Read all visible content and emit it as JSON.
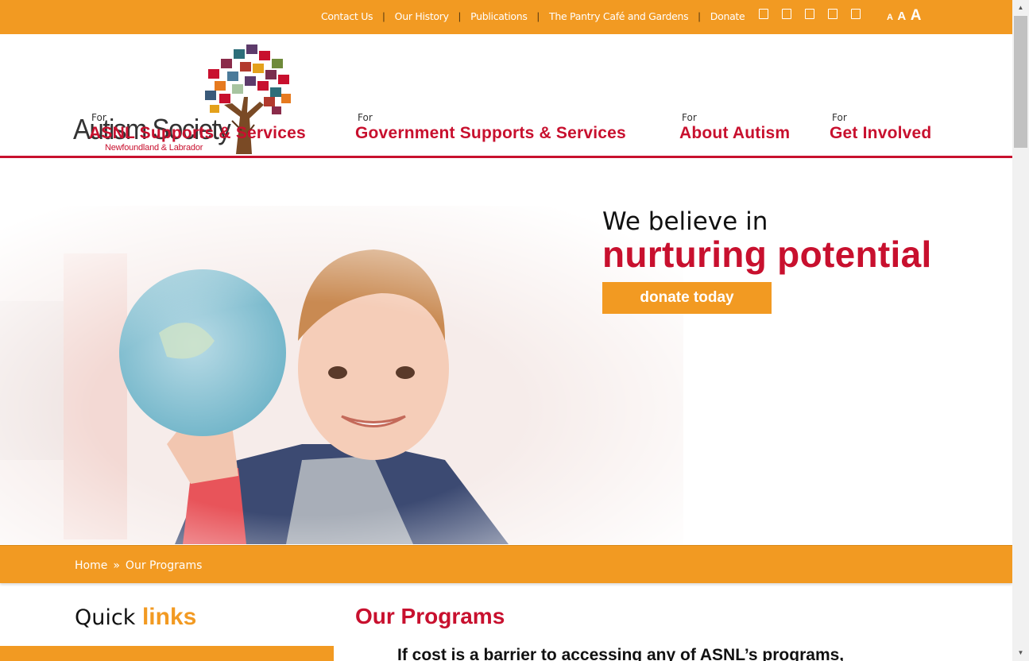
{
  "topbar": {
    "links": [
      "Contact Us",
      "Our History",
      "Publications",
      "The Pantry Café and Gardens",
      "Donate"
    ],
    "social_icons": [
      "facebook-icon",
      "twitter-icon",
      "instagram-icon",
      "youtube-icon",
      "linkedin-icon"
    ],
    "font_size_labels": [
      "A",
      "A",
      "A"
    ]
  },
  "logo": {
    "name": "Autism Society",
    "subtitle": "Newfoundland & Labrador"
  },
  "nav": [
    {
      "for": "For",
      "label": "ASNL Supports & Services"
    },
    {
      "for": "For",
      "label": "Government Supports & Services"
    },
    {
      "for": "For",
      "label": "About Autism"
    },
    {
      "for": "For",
      "label": "Get Involved"
    }
  ],
  "hero": {
    "line1": "We believe in",
    "line2": "nurturing potential",
    "button": "donate today"
  },
  "breadcrumb": {
    "home": "Home",
    "separator": "»",
    "current": "Our Programs"
  },
  "sidebar": {
    "title_plain": "Quick",
    "title_accent": "links"
  },
  "main": {
    "title": "Our Programs",
    "intro": "If cost is a barrier to accessing any of ASNL’s programs,"
  },
  "colors": {
    "accent_orange": "#f29a22",
    "brand_red": "#c8102e"
  }
}
